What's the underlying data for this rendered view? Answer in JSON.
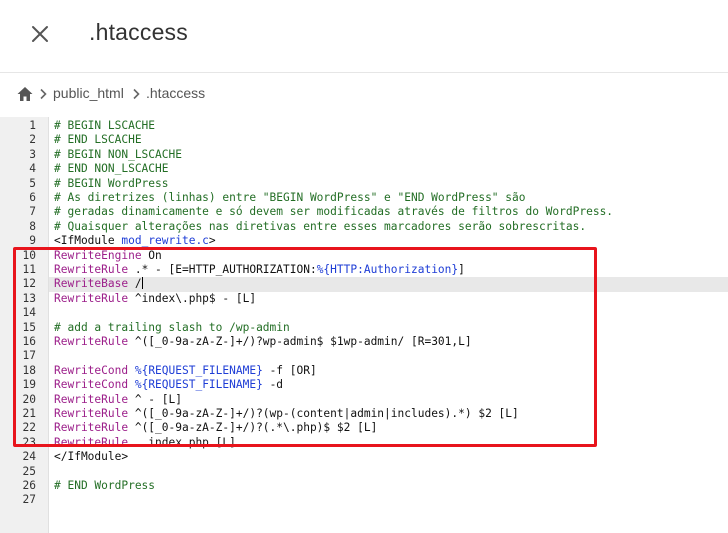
{
  "header": {
    "title": ".htaccess",
    "close_icon": "close-icon"
  },
  "breadcrumb": {
    "home_icon": "home-icon",
    "items": [
      "public_html",
      ".htaccess"
    ]
  },
  "editor": {
    "active_line": 12,
    "lines": [
      {
        "n": "1",
        "segs": [
          {
            "t": "# BEGIN LSCACHE",
            "c": "comment"
          }
        ]
      },
      {
        "n": "2",
        "segs": [
          {
            "t": "# END LSCACHE",
            "c": "comment"
          }
        ]
      },
      {
        "n": "3",
        "segs": [
          {
            "t": "# BEGIN NON_LSCACHE",
            "c": "comment"
          }
        ]
      },
      {
        "n": "4",
        "segs": [
          {
            "t": "# END NON_LSCACHE",
            "c": "comment"
          }
        ]
      },
      {
        "n": "5",
        "segs": [
          {
            "t": "# BEGIN WordPress",
            "c": "comment"
          }
        ]
      },
      {
        "n": "6",
        "segs": [
          {
            "t": "# As diretrizes (linhas) entre \"BEGIN WordPress\" e \"END WordPress\" são",
            "c": "comment"
          }
        ]
      },
      {
        "n": "7",
        "segs": [
          {
            "t": "# geradas dinamicamente e só devem ser modificadas através de filtros do WordPress.",
            "c": "comment"
          }
        ]
      },
      {
        "n": "8",
        "segs": [
          {
            "t": "# Quaisquer alterações nas diretivas entre esses marcadores serão sobrescritas.",
            "c": "comment"
          }
        ]
      },
      {
        "n": "9",
        "segs": [
          {
            "t": "<IfModule ",
            "c": "plain"
          },
          {
            "t": "mod_rewrite.c",
            "c": "var"
          },
          {
            "t": ">",
            "c": "plain"
          }
        ]
      },
      {
        "n": "10",
        "segs": [
          {
            "t": "RewriteEngine",
            "c": "kw"
          },
          {
            "t": " On",
            "c": "plain"
          }
        ]
      },
      {
        "n": "11",
        "segs": [
          {
            "t": "RewriteRule",
            "c": "kw"
          },
          {
            "t": " .* - [E=HTTP_AUTHORIZATION:",
            "c": "plain"
          },
          {
            "t": "%{HTTP:Authorization}",
            "c": "var"
          },
          {
            "t": "]",
            "c": "plain"
          }
        ]
      },
      {
        "n": "12",
        "segs": [
          {
            "t": "RewriteBase",
            "c": "kw"
          },
          {
            "t": " /",
            "c": "plain"
          }
        ],
        "cursor": true
      },
      {
        "n": "13",
        "segs": [
          {
            "t": "RewriteRule",
            "c": "kw"
          },
          {
            "t": " ^index\\.php$ - [L]",
            "c": "plain"
          }
        ]
      },
      {
        "n": "14",
        "segs": []
      },
      {
        "n": "15",
        "segs": [
          {
            "t": "# add a trailing slash to /wp-admin",
            "c": "comment"
          }
        ]
      },
      {
        "n": "16",
        "segs": [
          {
            "t": "RewriteRule",
            "c": "kw"
          },
          {
            "t": " ^([_0-9a-zA-Z-]+/)?wp-admin$ $1wp-admin/ [R=301,L]",
            "c": "plain"
          }
        ]
      },
      {
        "n": "17",
        "segs": []
      },
      {
        "n": "18",
        "segs": [
          {
            "t": "RewriteCond",
            "c": "kw"
          },
          {
            "t": " ",
            "c": "plain"
          },
          {
            "t": "%{REQUEST_FILENAME}",
            "c": "var"
          },
          {
            "t": " -f [OR]",
            "c": "plain"
          }
        ]
      },
      {
        "n": "19",
        "segs": [
          {
            "t": "RewriteCond",
            "c": "kw"
          },
          {
            "t": " ",
            "c": "plain"
          },
          {
            "t": "%{REQUEST_FILENAME}",
            "c": "var"
          },
          {
            "t": " -d",
            "c": "plain"
          }
        ]
      },
      {
        "n": "20",
        "segs": [
          {
            "t": "RewriteRule",
            "c": "kw"
          },
          {
            "t": " ^ - [L]",
            "c": "plain"
          }
        ]
      },
      {
        "n": "21",
        "segs": [
          {
            "t": "RewriteRule",
            "c": "kw"
          },
          {
            "t": " ^([_0-9a-zA-Z-]+/)?(wp-(content|admin|includes).*) $2 [L]",
            "c": "plain"
          }
        ]
      },
      {
        "n": "22",
        "segs": [
          {
            "t": "RewriteRule",
            "c": "kw"
          },
          {
            "t": " ^([_0-9a-zA-Z-]+/)?(.*\\.php)$ $2 [L]",
            "c": "plain"
          }
        ]
      },
      {
        "n": "23",
        "segs": [
          {
            "t": "RewriteRule",
            "c": "kw"
          },
          {
            "t": " . index.php [L]",
            "c": "plain"
          }
        ]
      },
      {
        "n": "24",
        "segs": [
          {
            "t": "</IfModule>",
            "c": "plain"
          }
        ]
      },
      {
        "n": "25",
        "segs": []
      },
      {
        "n": "26",
        "segs": [
          {
            "t": "# END WordPress",
            "c": "comment"
          }
        ]
      },
      {
        "n": "27",
        "segs": []
      }
    ]
  },
  "colors": {
    "comment": "#236e25",
    "keyword": "#9c1f8a",
    "variable": "#1e3dd6",
    "highlight_box": "#e8141c"
  }
}
